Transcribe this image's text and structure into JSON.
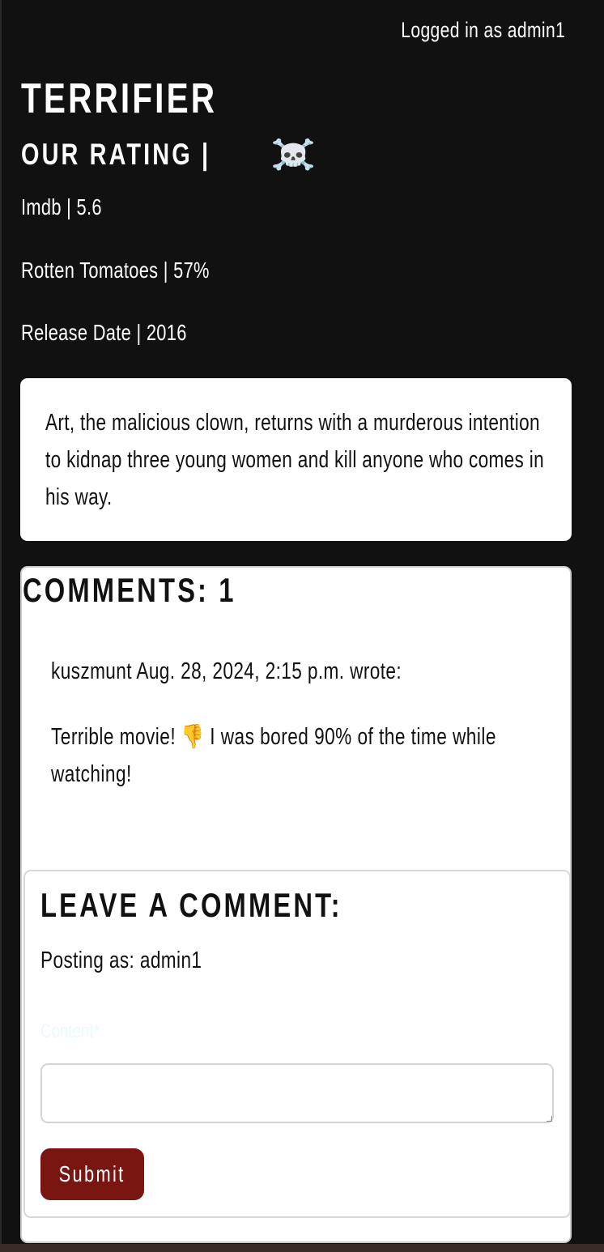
{
  "header": {
    "login_status": "Logged in as admin1"
  },
  "movie": {
    "title": "TERRIFIER",
    "our_rating_label": "OUR RATING |",
    "our_rating_icon": "☠️",
    "imdb": "Imdb | 5.6",
    "rotten_tomatoes": "Rotten Tomatoes | 57%",
    "release_date": "Release Date | 2016",
    "description": "Art, the malicious clown, returns with a murderous intention to kidnap three young women and kill anyone who comes in his way."
  },
  "comments": {
    "title": "COMMENTS: 1",
    "items": [
      {
        "header": "kuszmunt Aug. 28, 2024, 2:15 p.m. wrote:",
        "body": "Terrible movie! 👎 I was bored 90% of the time while watching!"
      }
    ]
  },
  "comment_form": {
    "title": "LEAVE A COMMENT:",
    "posting_as": "Posting as: admin1",
    "content_label": "Content*",
    "content_value": "",
    "submit_label": "Submit"
  },
  "colors": {
    "page_background": "#111111",
    "submit_button": "#7a1611",
    "card_background": "#ffffff"
  }
}
